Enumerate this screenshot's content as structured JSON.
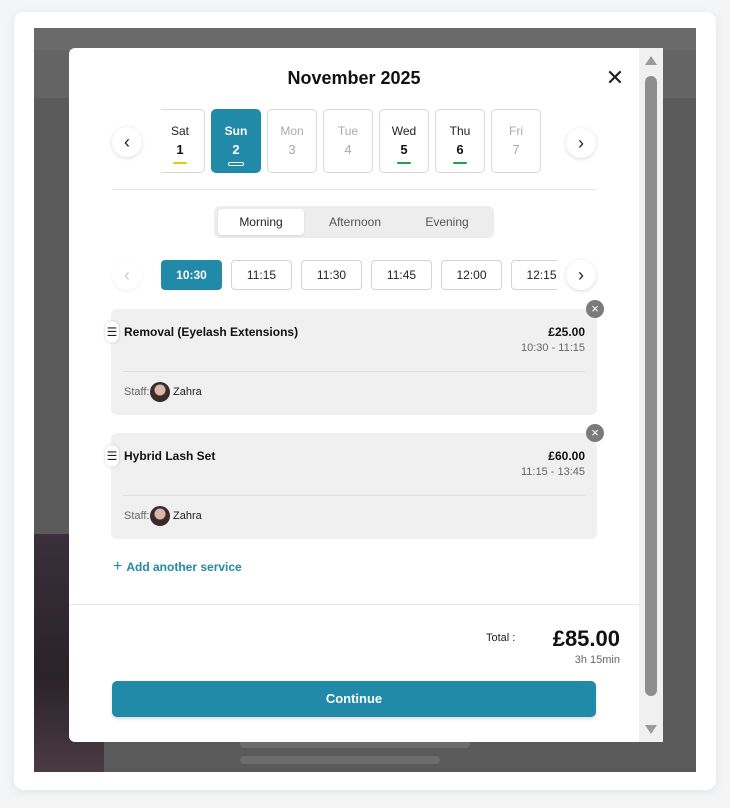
{
  "modal": {
    "title": "November 2025",
    "close_icon": "close-icon"
  },
  "days": [
    {
      "name": "Sat",
      "date": "1",
      "state": "available",
      "indicator": "#e8c800"
    },
    {
      "name": "Sun",
      "date": "2",
      "state": "selected",
      "indicator": "#ffffff"
    },
    {
      "name": "Mon",
      "date": "3",
      "state": "muted",
      "indicator": ""
    },
    {
      "name": "Tue",
      "date": "4",
      "state": "muted",
      "indicator": ""
    },
    {
      "name": "Wed",
      "date": "5",
      "state": "available",
      "indicator": "#1fa34a"
    },
    {
      "name": "Thu",
      "date": "6",
      "state": "available",
      "indicator": "#1fa34a"
    },
    {
      "name": "Fri",
      "date": "7",
      "state": "muted",
      "indicator": ""
    }
  ],
  "tabs": [
    {
      "label": "Morning",
      "active": true
    },
    {
      "label": "Afternoon",
      "active": false
    },
    {
      "label": "Evening",
      "active": false
    }
  ],
  "times": [
    "10:30",
    "11:15",
    "11:30",
    "11:45",
    "12:00",
    "12:15"
  ],
  "selected_time": "10:30",
  "services": [
    {
      "name": "Removal (Eyelash Extensions)",
      "price": "£25.00",
      "range": "10:30 - 11:15",
      "staff_label": "Staff:",
      "staff": "Zahra"
    },
    {
      "name": "Hybrid Lash Set",
      "price": "£60.00",
      "range": "11:15 - 13:45",
      "staff_label": "Staff:",
      "staff": "Zahra"
    }
  ],
  "add_service": "Add another service",
  "total": {
    "label": "Total :",
    "value": "£85.00",
    "duration": "3h 15min"
  },
  "continue_label": "Continue",
  "colors": {
    "accent": "#208aa8"
  }
}
